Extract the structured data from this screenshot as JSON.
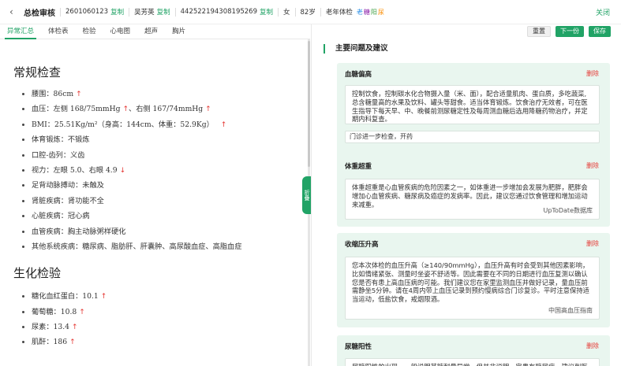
{
  "header": {
    "back_glyph": "‹",
    "title": "总检审核",
    "id_no": "2601060123",
    "copy_label": "复制",
    "name": "吴芳英",
    "id_card": "442522194308195269",
    "gender": "女",
    "age": "82岁",
    "exam_type": "老年体检",
    "mini_tags": [
      {
        "text": "老",
        "color": "#1e88e5"
      },
      {
        "text": "糖",
        "color": "#8e24aa"
      },
      {
        "text": "阳",
        "color": "#43a047"
      },
      {
        "text": "尿",
        "color": "#fb8c00"
      }
    ],
    "close_label": "关闭"
  },
  "tabs": [
    "异常汇总",
    "体检表",
    "检验",
    "心电图",
    "超声",
    "胸片"
  ],
  "left": {
    "sections": [
      {
        "title": "常规检查",
        "items": [
          {
            "text": "腰围：86cm",
            "flag": "↑"
          },
          {
            "text": "血压：左侧 168/75mmHg",
            "flag": "↑",
            "text2": "、右侧 167/74mmHg",
            "flag2": "↑"
          },
          {
            "text": "BMI：25.51Kg/m²（身高：144cm、体重：52.9Kg）",
            "flag": "↑"
          },
          {
            "text": "体育锻炼：不锻炼"
          },
          {
            "text": "口腔-齿列：义齿"
          },
          {
            "text": "视力：左眼 5.0、右眼 4.9",
            "flag": "↓"
          },
          {
            "text": "足背动脉搏动：未触及"
          },
          {
            "text": "肾脏疾病：肾功能不全"
          },
          {
            "text": "心脏疾病：冠心病"
          },
          {
            "text": "血管疾病：胸主动脉粥样硬化"
          },
          {
            "text": "其他系统疾病：糖尿病、脂肪肝、肝囊肿、高尿酸血症、高脂血症"
          }
        ]
      },
      {
        "title": "生化检验",
        "items": [
          {
            "text": "糖化血红蛋白：10.1",
            "flag": "↑"
          },
          {
            "text": "葡萄糖：10.8",
            "flag": "↑"
          },
          {
            "text": "尿素：13.4",
            "flag": "↑"
          },
          {
            "text": "肌酐：186",
            "flag": "↑"
          }
        ]
      }
    ],
    "collapse_label": "折叠"
  },
  "right": {
    "buttons": {
      "reset": "重置",
      "next": "下一份",
      "save": "保存"
    },
    "heading": "主要问题及建议",
    "delete_label": "删除",
    "cards": [
      {
        "title": "血糖偏高",
        "body": "控制饮食，控制碳水化合物摄入量（米、面），配合适量肌肉、蛋白质，多吃蔬菜,总含糖量高的水果及饮料、罐头等甜食。适当体育锻炼。饮食治疗无效者，可在医生指导下每天早、中、晚餐前测尿糖定性及每周测血糖后选用降糖药物治疗，并定期内科复查。",
        "note": "门诊进一步检查，开药"
      },
      {
        "title": "体重超重",
        "body": "体重超重是心血管疾病的危险因素之一，如体重进一步增加会发展为肥胖，肥胖会增加心血管疾病、糖尿病及癌症的发病率。因此，建议您通过饮食管理和增加运动来减重。",
        "source": "UpToDate数据库"
      },
      {
        "title": "收缩压升高",
        "body": "您本次体检的血压升高（≥140/90mmHg），血压升高有时会受到其他因素影响，比如情绪紧张、测量时坐姿不舒适等。因此需要在不同的日期进行血压复测以确认您是否有患上高血压病的可能。我们建议您在家里监测血压并做好记录，量血压前需静坐5分钟。请在4周内带上血压记录到预约慢病综合门诊复诊。平时注意保持适当运动，低盐饮食，戒烟限酒。",
        "source": "中国高血压指南"
      },
      {
        "title": "尿糖阳性",
        "body": "尿糖阳性的出现，一般说明其糖耐量异常，但并非说明一定患有糖尿病，建议到医院进一步检查血糖。"
      }
    ]
  }
}
